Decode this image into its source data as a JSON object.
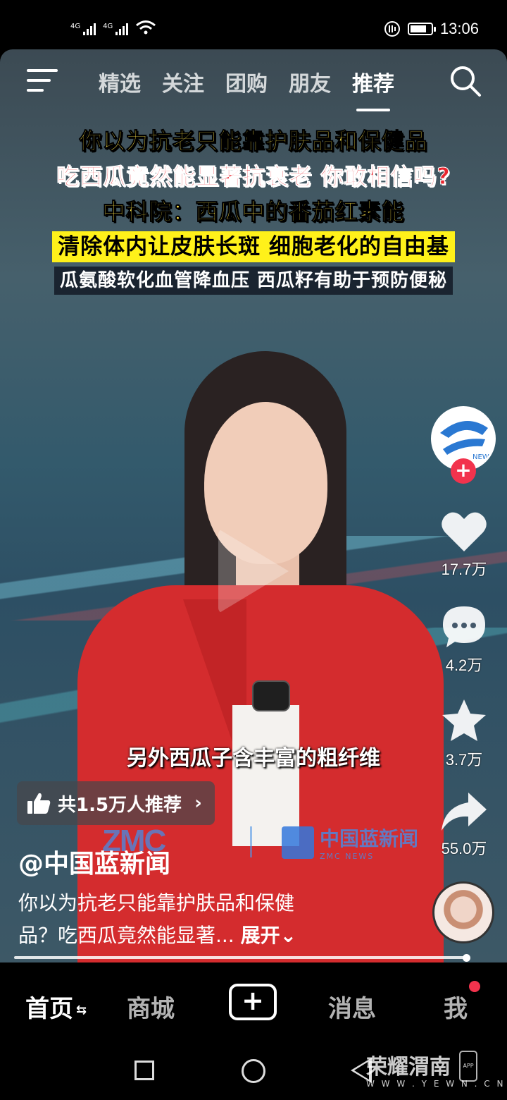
{
  "status_bar": {
    "signal1_label": "4G",
    "signal2_label": "4G",
    "time": "13:06",
    "battery_level": 0.8
  },
  "top_nav": {
    "tabs": [
      "精选",
      "关注",
      "团购",
      "朋友",
      "推荐"
    ],
    "active_tab": "推荐"
  },
  "video": {
    "caption_lines": [
      "你以为抗老只能靠护肤品和保健品",
      "吃西瓜竟然能显著抗衰老 你敢相信吗?",
      "中科院：西瓜中的番茄红素能",
      "清除体内让皮肤长斑 细胞老化的自由基",
      "瓜氨酸软化血管降血压  西瓜籽有助于预防便秘"
    ],
    "subtitle": "另外西瓜子含丰富的粗纤维",
    "watermark_left": "ZMC",
    "watermark_right": "中国蓝新闻",
    "watermark_right_sub": "ZMC NEWS",
    "avatar_badge_text": "NEWS",
    "progress": 0.985
  },
  "recommend": {
    "label": "共1.5万人推荐"
  },
  "author": "@中国蓝新闻",
  "description": {
    "text_line1": "你以为抗老只能靠护肤品和保健",
    "text_line2": "品？吃西瓜竟然能显著...",
    "expand_label": "展开"
  },
  "actions": {
    "likes": "17.7万",
    "comments": "4.2万",
    "favorites": "3.7万",
    "shares": "55.0万"
  },
  "bottom_nav": {
    "home": "首页",
    "shop": "商城",
    "add": "+",
    "messages": "消息",
    "me": "我"
  },
  "site_watermark": {
    "name": "荣耀渭南",
    "url": "W W W . Y E W N . C N",
    "app": "APP"
  },
  "colors": {
    "accent_red": "#f2334d",
    "caption_yellow": "#ffe54a"
  }
}
